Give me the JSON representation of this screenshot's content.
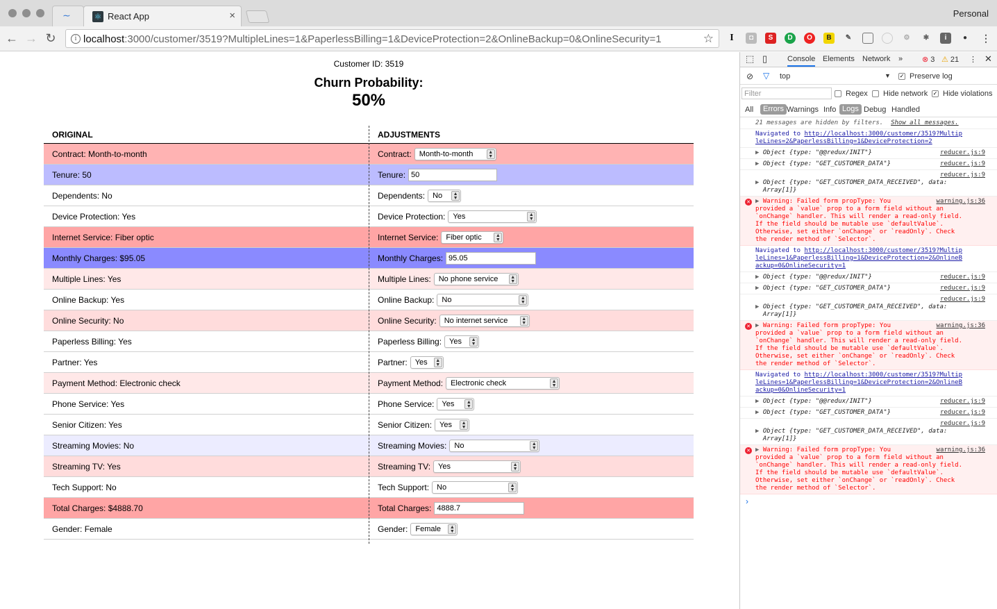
{
  "browser": {
    "tab_title": "React App",
    "profile": "Personal",
    "url_host": "localhost",
    "url_rest": ":3000/customer/3519?MultipleLines=1&PaperlessBilling=1&DeviceProtection=2&OnlineBackup=0&OnlineSecurity=1"
  },
  "page": {
    "customer_id": "Customer ID: 3519",
    "churn_label": "Churn Probability:",
    "churn_value": "50%",
    "col_original": "ORIGINAL",
    "col_adjustments": "ADJUSTMENTS",
    "rows": [
      {
        "original": "Contract: Month-to-month",
        "label": "Contract:",
        "value": "Month-to-month",
        "kind": "select"
      },
      {
        "original": "Tenure: 50",
        "label": "Tenure:",
        "value": "50",
        "kind": "input"
      },
      {
        "original": "Dependents: No",
        "label": "Dependents:",
        "value": "No",
        "kind": "select"
      },
      {
        "original": "Device Protection: Yes",
        "label": "Device Protection:",
        "value": "Yes",
        "kind": "select"
      },
      {
        "original": "Internet Service: Fiber optic",
        "label": "Internet Service:",
        "value": "Fiber optic",
        "kind": "select"
      },
      {
        "original": "Monthly Charges: $95.05",
        "label": "Monthly Charges:",
        "value": "95.05",
        "kind": "input"
      },
      {
        "original": "Multiple Lines: Yes",
        "label": "Multiple Lines:",
        "value": "No phone service",
        "kind": "select"
      },
      {
        "original": "Online Backup: Yes",
        "label": "Online Backup:",
        "value": "No",
        "kind": "select"
      },
      {
        "original": "Online Security: No",
        "label": "Online Security:",
        "value": "No internet service",
        "kind": "select"
      },
      {
        "original": "Paperless Billing: Yes",
        "label": "Paperless Billing:",
        "value": "Yes",
        "kind": "select"
      },
      {
        "original": "Partner: Yes",
        "label": "Partner:",
        "value": "Yes",
        "kind": "select"
      },
      {
        "original": "Payment Method: Electronic check",
        "label": "Payment Method:",
        "value": "Electronic check",
        "kind": "select"
      },
      {
        "original": "Phone Service: Yes",
        "label": "Phone Service:",
        "value": "Yes",
        "kind": "select"
      },
      {
        "original": "Senior Citizen: Yes",
        "label": "Senior Citizen:",
        "value": "Yes",
        "kind": "select"
      },
      {
        "original": "Streaming Movies: No",
        "label": "Streaming Movies:",
        "value": "No",
        "kind": "select"
      },
      {
        "original": "Streaming TV: Yes",
        "label": "Streaming TV:",
        "value": "Yes",
        "kind": "select"
      },
      {
        "original": "Tech Support: No",
        "label": "Tech Support:",
        "value": "No",
        "kind": "select"
      },
      {
        "original": "Total Charges: $4888.70",
        "label": "Total Charges:",
        "value": "4888.7",
        "kind": "input"
      },
      {
        "original": "Gender: Female",
        "label": "Gender:",
        "value": "Female",
        "kind": "select"
      }
    ]
  },
  "devtools": {
    "tabs": [
      "Console",
      "Elements",
      "Network"
    ],
    "error_count": "3",
    "warning_count": "21",
    "context": "top",
    "preserve_log": "Preserve log",
    "filter_placeholder": "Filter",
    "regex": "Regex",
    "hide_network": "Hide network",
    "hide_violations": "Hide violations",
    "levels": [
      "All",
      "Errors",
      "Warnings",
      "Info",
      "Logs",
      "Debug",
      "Handled"
    ],
    "hidden_msg": "21 messages are hidden by filters.",
    "show_all": "Show all messages.",
    "nav1_prefix": "Navigated to ",
    "nav1_url": "http://localhost:3000/customer/3519?Multip\nleLines=2&PaperlessBilling=1&DeviceProtection=2",
    "nav2_url": "http://localhost:3000/customer/3519?Multip\nleLines=1&PaperlessBilling=1&DeviceProtection=2&OnlineB\nackup=0&OnlineSecurity=1",
    "nav3_url": "http://localhost:3000/customer/3519?Multip\nleLines=1&PaperlessBilling=1&DeviceProtection=2&OnlineB\nackup=0&OnlineSecurity=1",
    "obj_init": "Object {type: \"@@redux/INIT\"}",
    "obj_get": "Object {type: \"GET_CUSTOMER_DATA\"}",
    "obj_received": "Object {type: \"GET_CUSTOMER_DATA_RECEIVED\", data:\n  Array[1]}",
    "reducer_src": "reducer.js:9",
    "warning_src": "warning.js:36",
    "warning_text": "Warning: Failed form propType: You\nprovided a `value` prop to a form field without an\n`onChange` handler. This will render a read-only field.\nIf the field should be mutable use `defaultValue`.\nOtherwise, set either `onChange` or `readOnly`. Check\nthe render method of `Selector`."
  }
}
